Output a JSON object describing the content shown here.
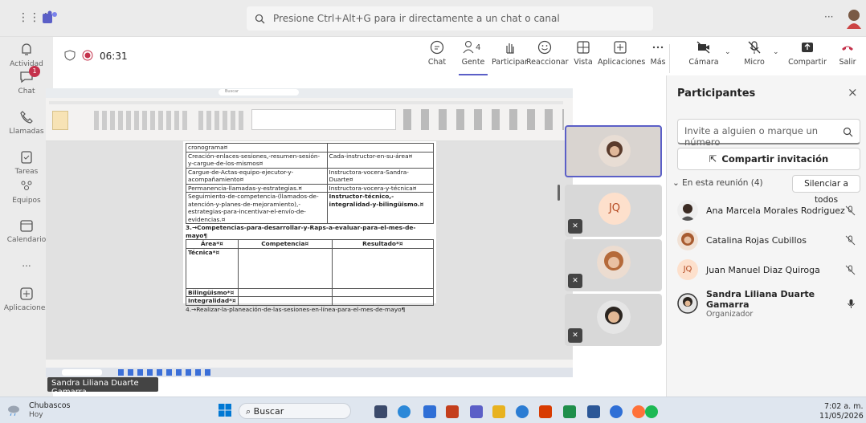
{
  "search": {
    "placeholder": "Presione Ctrl+Alt+G para ir directamente a un chat o canal"
  },
  "rail": {
    "items": [
      {
        "label": "Actividad",
        "icon": "bell-icon"
      },
      {
        "label": "Chat",
        "icon": "chat-icon",
        "badge": "1"
      },
      {
        "label": "Llamadas",
        "icon": "phone-icon"
      },
      {
        "label": "Tareas",
        "icon": "tasks-icon"
      },
      {
        "label": "Equipos",
        "icon": "teams-icon"
      },
      {
        "label": "Calendario",
        "icon": "calendar-icon"
      },
      {
        "label": "...",
        "icon": "more-icon"
      },
      {
        "label": "Aplicaciones",
        "icon": "apps-icon"
      }
    ]
  },
  "meeting": {
    "timer": "06:31",
    "toolbar": {
      "chat": "Chat",
      "people": "Gente",
      "people_count": "4",
      "raise": "Participar",
      "react": "Reaccionar",
      "view": "Vista",
      "apps": "Aplicaciones",
      "more": "Más",
      "camera": "Cámara",
      "mic": "Micro",
      "share": "Compartir",
      "leave": "Salir"
    },
    "presenter_tooltip": "Sandra Liliana Duarte Gamarra",
    "tile_initials": "JQ"
  },
  "document": {
    "rows": [
      [
        "cronograma¤",
        ""
      ],
      [
        "Creación-enlaces-sesiones,-resumen-sesión-y-cargue-de-los-mismos¤",
        "Cada-instructor-en-su-área¤"
      ],
      [
        "Cargue-de-Actas-equipo-ejecutor-y-acompañamiento¤",
        "Instructora-vocera-Sandra-Duarte¤"
      ],
      [
        "Permanencia-llamadas-y-estrategias.¤",
        "Instructora-vocera-y-técnica¤"
      ],
      [
        "Seguimiento-de-competencia-(llamados-de-atención-y-planes-de-mejoramiento),-estrategias-para-incentivar-el-envío-de-evidencias.¤",
        "Instructor-técnico,-integralidad-y-bilingüismo.¤"
      ]
    ],
    "heading3": "3.→Competencias-para-desarrollar-y-Raps-a-evaluar-para-el-mes-de-mayo¶",
    "table2_headers": [
      "Área*¤",
      "Competencia¤",
      "Resultado*¤"
    ],
    "table2_rows": [
      "Técnica*¤",
      "Bilingüismo*¤",
      "Integralidad*¤"
    ],
    "heading4": "4.→Realizar-la-planeación-de-las-sesiones-en-línea-para-el-mes-de-mayo¶",
    "word_search": "Buscar"
  },
  "participants": {
    "title": "Participantes",
    "invite_placeholder": "Invite a alguien o marque un número",
    "share_invite": "Compartir invitación",
    "in_meeting": "En esta reunión (4)",
    "mute_all": "Silenciar a todos",
    "list": [
      {
        "name": "Ana Marcela Morales Rodriguez",
        "role": ""
      },
      {
        "name": "Catalina Rojas Cubillos",
        "role": ""
      },
      {
        "name": "Juan Manuel Diaz Quiroga",
        "role": "",
        "initials": "JQ"
      },
      {
        "name": "Sandra Liliana Duarte Gamarra",
        "role": "Organizador"
      }
    ]
  },
  "taskbar": {
    "weather": "Chubascos",
    "weather_sub": "Hoy",
    "search": "Buscar",
    "time": "7:02 a. m.",
    "date": "11/05/2026"
  },
  "colors": {
    "accent": "#5b5fc7",
    "leave": "#c4314b",
    "badge": "#c4314b"
  }
}
